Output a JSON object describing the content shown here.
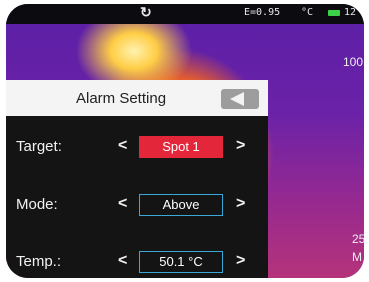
{
  "status_bar": {
    "emissivity": "E=0.95",
    "unit": "°C",
    "time": "12"
  },
  "scale": {
    "top": "100",
    "bottom_line1": "25",
    "bottom_line2": "M"
  },
  "dialog": {
    "title": "Alarm Setting",
    "rows": [
      {
        "label": "Target:",
        "value": "Spot 1",
        "selected": true
      },
      {
        "label": "Mode:",
        "value": "Above",
        "selected": false
      },
      {
        "label": "Temp.:",
        "value": "50.1 °C",
        "selected": false
      }
    ],
    "prev_glyph": "<",
    "next_glyph": ">"
  },
  "colors": {
    "selected_value_bg": "#e3263a",
    "value_border": "#3aa7d8",
    "battery": "#3bd24a"
  }
}
